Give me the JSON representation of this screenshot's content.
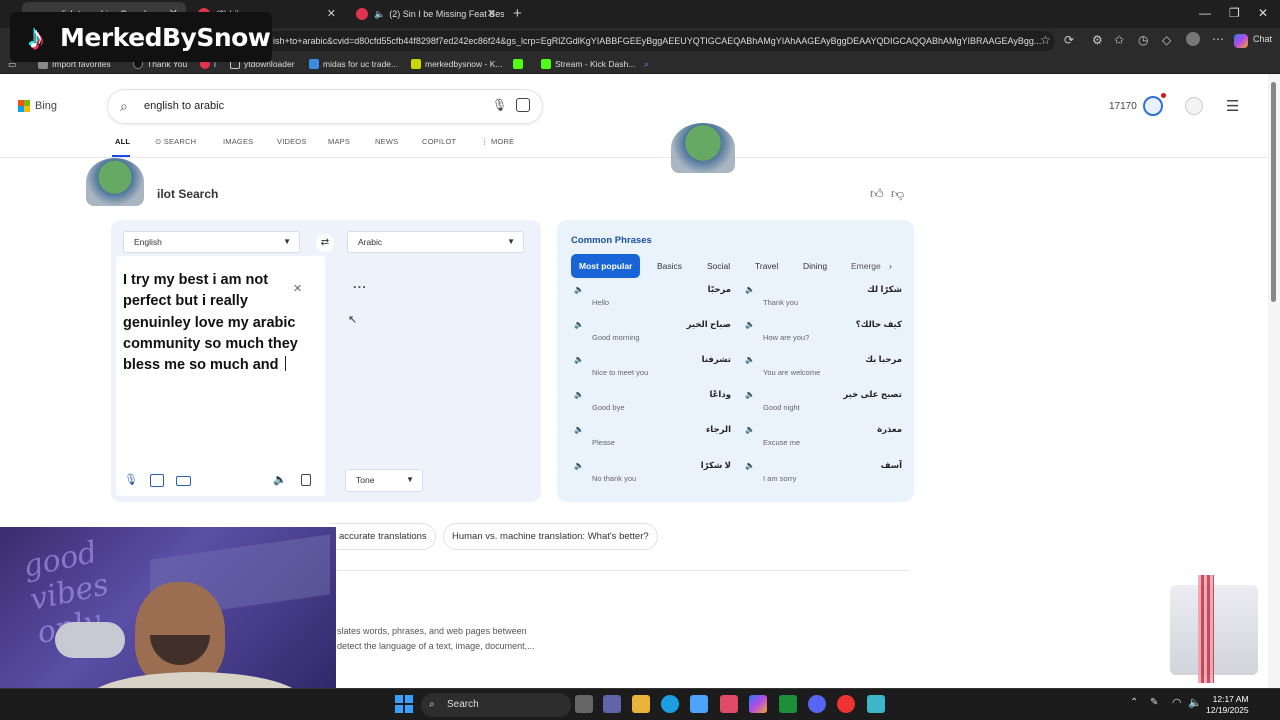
{
  "watermark": {
    "name": "MerkedBySnow"
  },
  "browser": {
    "tabs": [
      {
        "label": "lish to arabic - Search",
        "active": true
      },
      {
        "label": "(2) Library",
        "active": false
      },
      {
        "label": "(2) Sin I be Missing Feat Beso",
        "active": false
      }
    ],
    "url": "ish+to+arabic&cvid=d80cfd55cfb44f8298f7ed242ec86f24&gs_lcrp=EgRlZGdlKgYIABBFGEEyBggAEEUYQTIGCAEQABhAMgYIAhAAGEAyBggDEAAYQDIGCAQQABhAMgYIBRAAGEAyBgg...",
    "chat_label": "Chat",
    "favorites": [
      "Import favorites",
      "Thank You",
      "i",
      "ytdownloader",
      "midas for uc trade...",
      "merkedbysnow - K...",
      "Stream - Kick Dash..."
    ]
  },
  "bing": {
    "logo": "Bing",
    "query": "english to arabic",
    "nav": [
      "ALL",
      "SEARCH",
      "IMAGES",
      "VIDEOS",
      "MAPS",
      "NEWS",
      "COPILOT",
      "MORE"
    ],
    "rewards_points": "17170"
  },
  "copilot_title": "ilot Search",
  "translator": {
    "source_lang": "English",
    "target_lang": "Arabic",
    "source_text": "I try my best i am not perfect but i really genuinley love my arabic community so much they bless me so much and ",
    "tone_label": "Tone",
    "loading": "..."
  },
  "phrases": {
    "title": "Common Phrases",
    "tabs": [
      "Most popular",
      "Basics",
      "Social",
      "Travel",
      "Dining",
      "Emerge"
    ],
    "items": [
      {
        "ar": "مرحبًا",
        "en": "Hello"
      },
      {
        "ar": "شكرًا لك",
        "en": "Thank you"
      },
      {
        "ar": "صباح الخير",
        "en": "Good morning"
      },
      {
        "ar": "كيف حالك؟",
        "en": "How are you?"
      },
      {
        "ar": "تشرفنا",
        "en": "Nice to meet you"
      },
      {
        "ar": "مرحبا بك",
        "en": "You are welcome"
      },
      {
        "ar": "وداعًا",
        "en": "Good bye"
      },
      {
        "ar": "تصبح على خير",
        "en": "Good night"
      },
      {
        "ar": "الرجاء",
        "en": "Please"
      },
      {
        "ar": "معذرة",
        "en": "Excuse me"
      },
      {
        "ar": "لا شكرًا",
        "en": "No thank you"
      },
      {
        "ar": "آسف",
        "en": "I am sorry"
      }
    ]
  },
  "chips": [
    "accurate translations",
    "Human vs. machine translation: What's better?"
  ],
  "body_lines": [
    "slates words, phrases, and web pages between",
    "detect the language of a text, image, document,..."
  ],
  "webcam_text": "good\nvibes\nonly",
  "taskbar": {
    "search": "Search",
    "time": "12:17 AM",
    "date": "12/19/2025"
  }
}
